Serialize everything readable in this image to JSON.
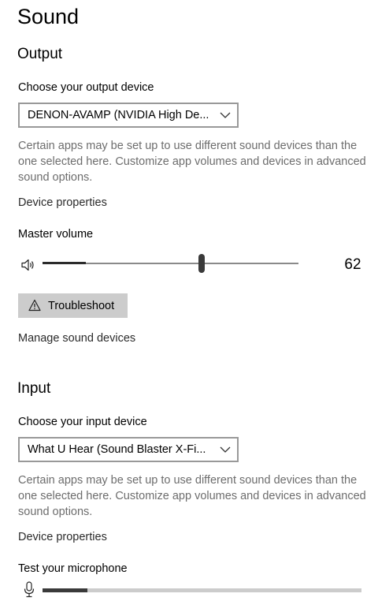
{
  "page": {
    "title": "Sound"
  },
  "output": {
    "title": "Output",
    "device_label": "Choose your output device",
    "device_value": "DENON-AVAMP (NVIDIA High De...",
    "help_text": "Certain apps may be set up to use different sound devices than the one selected here. Customize app volumes and devices in advanced sound options.",
    "properties_link": "Device properties",
    "volume_label": "Master volume",
    "volume_value": "62",
    "volume_level": 0.62,
    "volume_meter_level": 0.17,
    "troubleshoot_label": "Troubleshoot",
    "manage_link": "Manage sound devices"
  },
  "input": {
    "title": "Input",
    "device_label": "Choose your input device",
    "device_value": "What U Hear (Sound Blaster X-Fi...",
    "help_text": "Certain apps may be set up to use different sound devices than the one selected here. Customize app volumes and devices in advanced sound options.",
    "properties_link": "Device properties",
    "mic_test_label": "Test your microphone",
    "mic_level": 0.14
  },
  "icons": {
    "speaker": "speaker-icon",
    "chevron": "chevron-down-icon",
    "warning": "warning-icon",
    "microphone": "microphone-icon"
  },
  "colors": {
    "secondary_text": "#6d6d6d",
    "dropdown_border": "#999999",
    "button_bg": "#cccccc",
    "slider_thumb": "#3a3a3a"
  }
}
